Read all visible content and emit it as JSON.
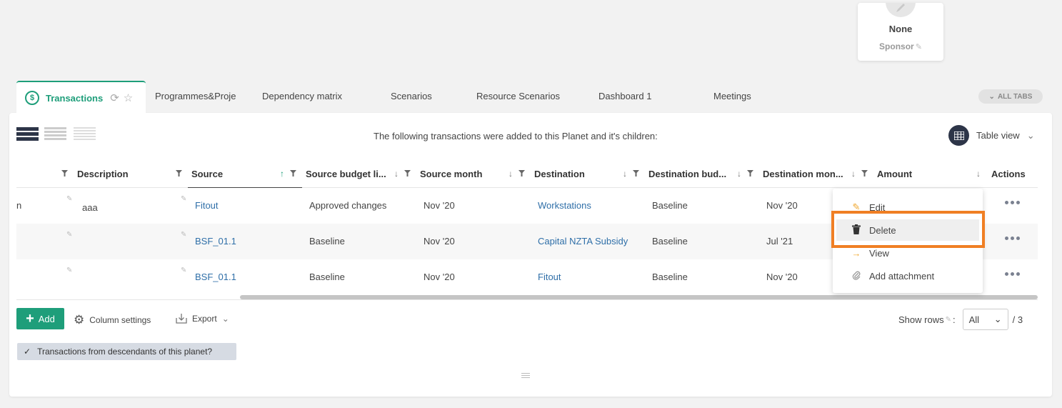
{
  "sponsor": {
    "name": "None",
    "role": "Sponsor"
  },
  "tabs": {
    "active": {
      "label": "Transactions",
      "icon": "dollar-circle-icon"
    },
    "items": [
      "Programmes&Proje",
      "Dependency matrix",
      "Scenarios",
      "Resource Scenarios",
      "Dashboard 1",
      "Meetings"
    ],
    "all_tabs_label": "ALL TABS"
  },
  "panel": {
    "title": "The following transactions were added to this Planet and it's children:",
    "view_label": "Table view"
  },
  "table": {
    "columns": [
      "Description",
      "Source",
      "Source budget li...",
      "Source month",
      "Destination",
      "Destination bud...",
      "Destination mon...",
      "Amount",
      "Actions"
    ],
    "sorted_column": "Source",
    "rows": [
      {
        "truncated": "n",
        "description": "aaa",
        "source": "Fitout",
        "source_budget": "Approved changes",
        "source_month": "Nov '20",
        "destination": "Workstations",
        "destination_budget": "Baseline",
        "destination_month": "Nov '20"
      },
      {
        "truncated": "",
        "description": "",
        "source": "BSF_01.1",
        "source_budget": "Baseline",
        "source_month": "Nov '20",
        "destination": "Capital NZTA Subsidy",
        "destination_budget": "Baseline",
        "destination_month": "Jul '21"
      },
      {
        "truncated": "",
        "description": "",
        "source": "BSF_01.1",
        "source_budget": "Baseline",
        "source_month": "Nov '20",
        "destination": "Fitout",
        "destination_budget": "Baseline",
        "destination_month": "Nov '20"
      }
    ]
  },
  "context_menu": {
    "items": [
      {
        "label": "Edit",
        "icon": "pencil-icon"
      },
      {
        "label": "Delete",
        "icon": "trash-icon",
        "highlighted": true
      },
      {
        "label": "View",
        "icon": "arrow-right-icon"
      },
      {
        "label": "Add attachment",
        "icon": "paperclip-icon"
      }
    ]
  },
  "footer": {
    "add_label": "Add",
    "column_settings_label": "Column settings",
    "export_label": "Export",
    "show_rows_label": "Show rows",
    "show_rows_value": "All",
    "total": "/ 3",
    "descendants_label": "Transactions from descendants of this planet?"
  },
  "colors": {
    "accent": "#1e9e7a",
    "link": "#2f6fa8",
    "highlight": "#f07f24",
    "dark": "#2d3548"
  }
}
